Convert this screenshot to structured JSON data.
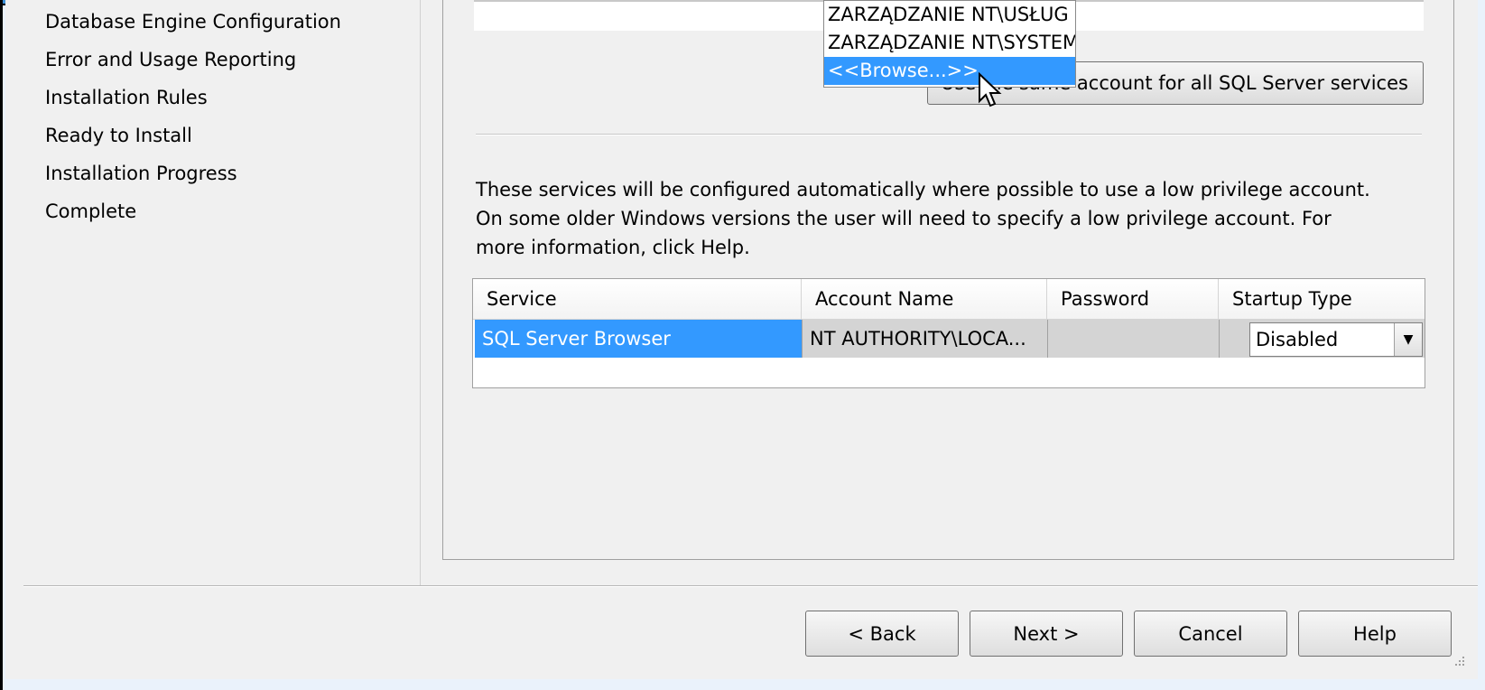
{
  "nav": {
    "items": [
      {
        "label": "Database Engine Configuration"
      },
      {
        "label": "Error and Usage Reporting"
      },
      {
        "label": "Installation Rules"
      },
      {
        "label": "Ready to Install"
      },
      {
        "label": "Installation Progress"
      },
      {
        "label": "Complete"
      }
    ]
  },
  "top_panel": {
    "same_account_button": "Use the same account for all SQL Server services"
  },
  "account_dropdown": {
    "options": [
      {
        "label": "ZARZĄDZANIE NT\\USŁUG"
      },
      {
        "label": "ZARZĄDZANIE NT\\SYSTEM"
      },
      {
        "label": "<<Browse...>>",
        "highlighted": true
      }
    ]
  },
  "info": {
    "line1": "These services will be configured automatically where possible to use a low privilege account.",
    "line2": "On some older Windows versions the user will need to specify a low privilege account.  For",
    "line3": "more information, click Help."
  },
  "services_table": {
    "columns": [
      "Service",
      "Account Name",
      "Password",
      "Startup Type"
    ],
    "rows": [
      {
        "service": "SQL Server Browser",
        "account_name": "NT AUTHORITY\\LOCA...",
        "password": "",
        "startup_type": "Disabled"
      }
    ]
  },
  "footer": {
    "back": "< Back",
    "next": "Next >",
    "cancel": "Cancel",
    "help": "Help"
  },
  "colors": {
    "selection": "#3399ff",
    "window_bg": "#f0f0f0"
  },
  "icons": {
    "cursor": "arrow-cursor-icon",
    "dropdown_arrow": "chevron-down-icon",
    "resize_grip": "resize-grip-icon"
  }
}
